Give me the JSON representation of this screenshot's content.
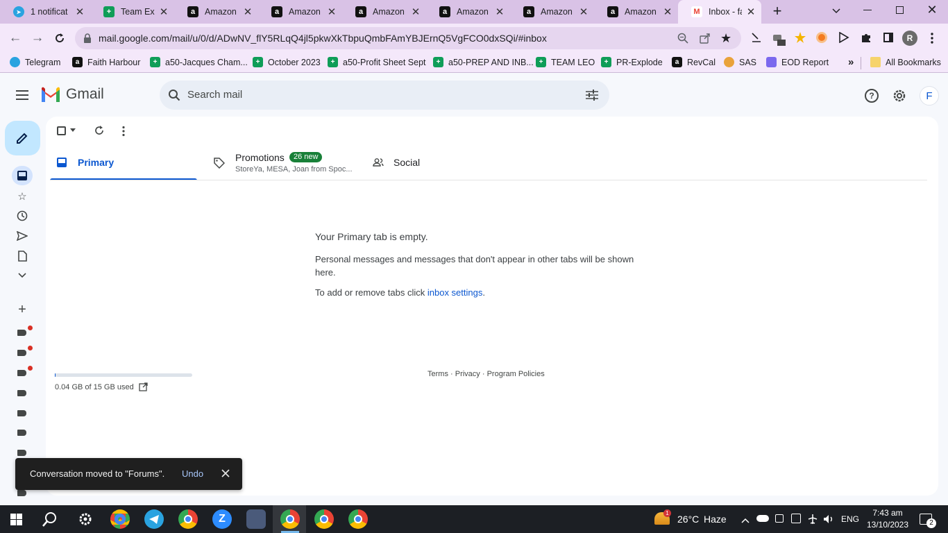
{
  "browser": {
    "tabs": [
      {
        "title": "1 notificat",
        "favicon": "telegram-icon",
        "color": "#2aa3e0"
      },
      {
        "title": "Team Expl",
        "favicon": "sheets-icon",
        "color": "#0f9d58"
      },
      {
        "title": "Amazon",
        "favicon": "amazon-icon",
        "color": "#111111"
      },
      {
        "title": "Amazon",
        "favicon": "amazon-icon",
        "color": "#111111"
      },
      {
        "title": "Amazon",
        "favicon": "amazon-icon",
        "color": "#111111"
      },
      {
        "title": "Amazon",
        "favicon": "amazon-icon",
        "color": "#111111"
      },
      {
        "title": "Amazon",
        "favicon": "amazon-icon",
        "color": "#111111"
      },
      {
        "title": "Amazon",
        "favicon": "amazon-icon",
        "color": "#111111"
      },
      {
        "title": "Inbox - fa",
        "favicon": "gmail-icon",
        "color": "#ea4335"
      }
    ],
    "url": "mail.google.com/mail/u/0/d/ADwNV_flY5RLqQ4jl5pkwXkTbpuQmbFAmYBJErnQ5VgFCO0dxSQi/#inbox",
    "profile_initial": "R",
    "bookmarks": [
      {
        "label": "Telegram",
        "icon": "telegram-icon",
        "color": "#2aa3e0"
      },
      {
        "label": "Faith Harbour",
        "icon": "amazon-icon",
        "color": "#111111"
      },
      {
        "label": "a50-Jacques Cham...",
        "icon": "sheets-icon",
        "color": "#0f9d58"
      },
      {
        "label": "October 2023",
        "icon": "sheets-icon",
        "color": "#0f9d58"
      },
      {
        "label": "a50-Profit Sheet Sept",
        "icon": "sheets-icon",
        "color": "#0f9d58"
      },
      {
        "label": "a50-PREP AND INB...",
        "icon": "sheets-icon",
        "color": "#0f9d58"
      },
      {
        "label": "TEAM LEO",
        "icon": "sheets-icon",
        "color": "#0f9d58"
      },
      {
        "label": "PR-Explode",
        "icon": "sheets-icon",
        "color": "#0f9d58"
      },
      {
        "label": "RevCal",
        "icon": "amazon-icon",
        "color": "#111111"
      },
      {
        "label": "SAS",
        "icon": "sas-icon",
        "color": "#e9a23b"
      },
      {
        "label": "EOD Report",
        "icon": "clickup-icon",
        "color": "#7b68ee"
      }
    ],
    "all_bookmarks": "All Bookmarks",
    "more_bookmarks": "»"
  },
  "gmail": {
    "brand": "Gmail",
    "search_placeholder": "Search mail",
    "account_initial": "F",
    "tabs": {
      "primary": "Primary",
      "promotions": "Promotions",
      "promotions_badge": "26 new",
      "promotions_sub": "StoreYa, MESA, Joan from Spoc...",
      "social": "Social"
    },
    "empty_title": "Your Primary tab is empty.",
    "empty_desc": "Personal messages and messages that don't appear in other tabs will be shown here.",
    "settings_prefix": "To add or remove tabs click ",
    "settings_link": "inbox settings",
    "settings_suffix": ".",
    "footer": {
      "terms": "Terms",
      "sep": " · ",
      "privacy": "Privacy",
      "policies": "Program Policies"
    },
    "storage": {
      "text": "0.04 GB of 15 GB used",
      "fraction": 0.003
    },
    "snackbar": {
      "message": "Conversation moved to \"Forums\".",
      "undo": "Undo"
    },
    "colors": {
      "accent": "#0b57d0",
      "badge": "#188038",
      "snackbar_bg": "#1f1f1f"
    }
  },
  "taskbar": {
    "weather_temp": "26°C",
    "weather_desc": "Haze",
    "weather_alert": "1",
    "language": "ENG",
    "time": "7:43 am",
    "date": "13/10/2023",
    "notifications": "2"
  }
}
